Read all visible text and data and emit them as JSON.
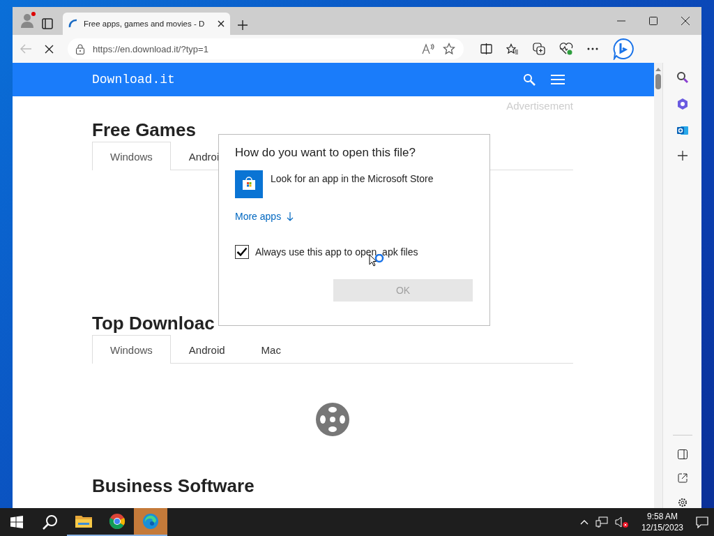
{
  "browser": {
    "tab_title": "Free apps, games and movies - D",
    "address": "https://en.download.it/?typ=1"
  },
  "site": {
    "logo": "Download.it",
    "advertisement": "Advertisement",
    "sections": [
      {
        "heading": "Free Games",
        "tabs": [
          {
            "label": "Windows",
            "selected": true
          },
          {
            "label": "Androi",
            "selected": false
          }
        ]
      },
      {
        "heading": "Top Downloac",
        "tabs": [
          {
            "label": "Windows",
            "selected": true
          },
          {
            "label": "Android",
            "selected": false
          },
          {
            "label": "Mac",
            "selected": false
          }
        ],
        "loading": true
      },
      {
        "heading": "Business Software"
      }
    ]
  },
  "dialog": {
    "title": "How do you want to open this file?",
    "option": "Look for an app in the Microsoft Store",
    "more_link": "More apps",
    "checkbox": {
      "label": "Always use this app to open .apk files",
      "checked": true
    },
    "ok_button": {
      "label": "OK",
      "disabled": true
    }
  },
  "taskbar": {
    "apps": [
      {
        "kind": "explorer",
        "active": false
      },
      {
        "kind": "chrome",
        "active": false
      },
      {
        "kind": "edge",
        "active": true
      }
    ],
    "time": "9:58 AM",
    "date": "12/15/2023"
  }
}
